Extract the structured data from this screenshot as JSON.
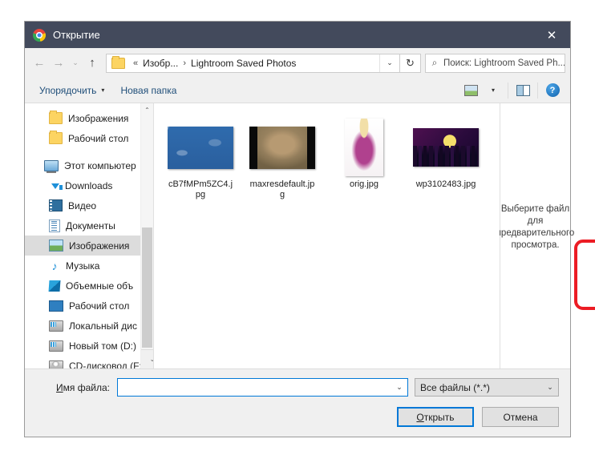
{
  "window": {
    "title": "Открытие",
    "app_icon": "chrome-icon",
    "close_label": "✕",
    "titlebar_color": "#434a5c"
  },
  "navigation": {
    "back_icon": "←",
    "forward_icon": "→",
    "recent_icon": "⌄",
    "up_icon": "↑",
    "breadcrumb": {
      "folder_icon": "folder-icon",
      "overflow": "«",
      "parent": "Изобр...",
      "separator1": "›",
      "current": "Lightroom Saved Photos"
    },
    "address_dropdown_icon": "⌄",
    "refresh_icon": "↻",
    "search": {
      "icon": "search-icon",
      "placeholder": "Поиск: Lightroom Saved Ph..."
    }
  },
  "toolbar": {
    "organize_label": "Упорядочить",
    "organize_caret": "▾",
    "new_folder_label": "Новая папка",
    "view_icon": "view-mode-icon",
    "view_caret": "▾",
    "preview_pane_icon": "preview-pane-icon",
    "help_icon": "?"
  },
  "sidebar": {
    "items": [
      {
        "label": "Изображения",
        "icon": "folder-icon",
        "indent": 1,
        "selected": false,
        "gap": false
      },
      {
        "label": "Рабочий стол",
        "icon": "folder-icon",
        "indent": 1,
        "selected": false,
        "gap": false
      },
      {
        "label": "Этот компьютер",
        "icon": "computer-icon",
        "indent": 0,
        "selected": false,
        "gap": true
      },
      {
        "label": "Downloads",
        "icon": "downloads-icon",
        "indent": 1,
        "selected": false,
        "gap": false
      },
      {
        "label": "Видео",
        "icon": "video-icon",
        "indent": 1,
        "selected": false,
        "gap": false
      },
      {
        "label": "Документы",
        "icon": "documents-icon",
        "indent": 1,
        "selected": false,
        "gap": false
      },
      {
        "label": "Изображения",
        "icon": "pictures-icon",
        "indent": 1,
        "selected": true,
        "gap": false
      },
      {
        "label": "Музыка",
        "icon": "music-icon",
        "indent": 1,
        "selected": false,
        "gap": false
      },
      {
        "label": "Объемные объ",
        "icon": "3d-objects-icon",
        "indent": 1,
        "selected": false,
        "gap": false
      },
      {
        "label": "Рабочий стол",
        "icon": "desktop-icon",
        "indent": 1,
        "selected": false,
        "gap": false
      },
      {
        "label": "Локальный дис",
        "icon": "drive-icon",
        "indent": 1,
        "selected": false,
        "gap": false
      },
      {
        "label": "Новый том (D:)",
        "icon": "drive-icon",
        "indent": 1,
        "selected": false,
        "gap": false
      },
      {
        "label": "CD-дисковод (F:",
        "icon": "cd-drive-icon",
        "indent": 1,
        "selected": false,
        "gap": false
      }
    ],
    "scroll_up_icon": "⌃",
    "scroll_down_icon": "⌄"
  },
  "files": [
    {
      "name": "cB7fMPm5ZC4.jpg",
      "thumb": "th-blueprint"
    },
    {
      "name": "maxresdefault.jpg",
      "thumb": "th-sepia"
    },
    {
      "name": "orig.jpg",
      "thumb": "th-girl"
    },
    {
      "name": "wp3102483.jpg",
      "thumb": "th-city"
    }
  ],
  "annotation": {
    "type": "highlight-rectangle",
    "target": "wp3102483.jpg",
    "color": "#ec1c24"
  },
  "preview": {
    "message": "Выберите файл для предварительного просмотра."
  },
  "footer": {
    "filename_label_accel": "И",
    "filename_label_rest": "мя файла:",
    "filename_value": "",
    "filename_caret": "⌄",
    "filter_value": "Все файлы (*.*)",
    "filter_caret": "⌄",
    "open_accel": "О",
    "open_rest": "ткрыть",
    "cancel_label": "Отмена"
  }
}
